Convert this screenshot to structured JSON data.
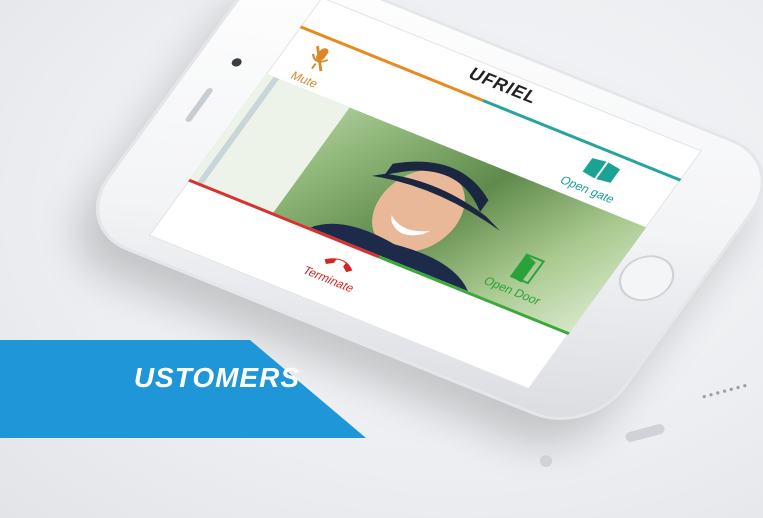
{
  "app": {
    "brand_logo": "UFRIEL",
    "buttons": {
      "mute": "Mute",
      "open_gate": "Open gate",
      "open_door": "Open Door",
      "terminate": "Terminate"
    },
    "colors": {
      "mute": "#d9882a",
      "open_gate": "#1aa394",
      "terminate": "#d32727",
      "open_door": "#2aa23a",
      "banner": "#1f96d8"
    },
    "icons": {
      "mute": "mic-muted-icon",
      "open_gate": "gate-icon",
      "open_door": "door-icon",
      "terminate": "phone-hangup-icon"
    }
  },
  "banner": {
    "text": "USTOMERS"
  }
}
